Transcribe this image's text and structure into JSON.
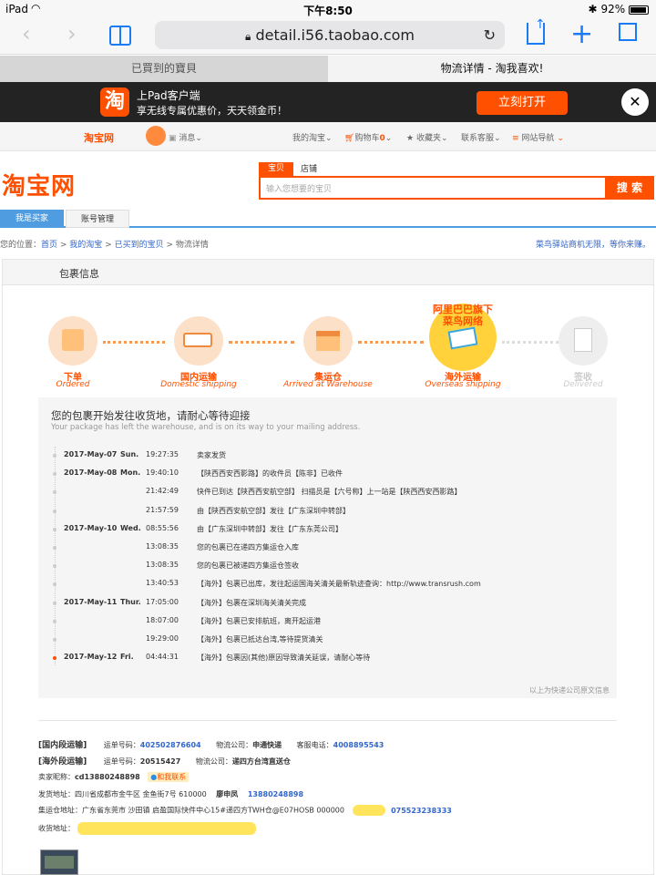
{
  "status": {
    "device": "iPad",
    "time": "下午8:50",
    "battery": "92%"
  },
  "browser": {
    "url": "detail.i56.taobao.com"
  },
  "tabs": [
    {
      "label": "已買到的寶貝"
    },
    {
      "label": "物流详情 - 淘我喜欢!"
    }
  ],
  "banner": {
    "logo": "淘",
    "line1": "上Pad客户端",
    "line2": "享无线专属优惠价，天天领金币！",
    "open": "立刻打开",
    "close": "✕"
  },
  "sitenav": {
    "brand": "淘宝网",
    "messages": "消息",
    "my_taobao": "我的淘宝",
    "cart": "购物车",
    "cart_count": "0",
    "favorites": "收藏夹",
    "service": "联系客服",
    "sitemap": "网站导航"
  },
  "header": {
    "logo": "淘宝网",
    "tab_baby": "宝贝",
    "tab_shop": "店铺",
    "placeholder": "输入您想要的宝贝",
    "search": "搜 索"
  },
  "account_tabs": [
    "我是买家",
    "账号管理"
  ],
  "breadcrumb": {
    "prefix": "您的位置：",
    "home": "首页",
    "my": "我的淘宝",
    "bought": "已买到的宝贝",
    "current": "物流详情",
    "right": "菜鸟驿站商机无限，等你来赚。"
  },
  "package": {
    "title": "包裹信息",
    "steps": [
      {
        "cn": "下单",
        "en": "Ordered"
      },
      {
        "cn": "国内运输",
        "en": "Domestic shipping"
      },
      {
        "cn": "集运仓",
        "en": "Arrived at Warehouse"
      },
      {
        "cn": "海外运输",
        "en": "Overseas shipping"
      },
      {
        "cn": "签收",
        "en": "Delivered"
      }
    ],
    "cainiao": "阿里巴巴旗下\n菜鸟网络",
    "status_cn": "您的包裹开始发往收货地，请耐心等待迎接",
    "status_en": "Your package has left the warehouse, and is on its way to your mailing address.",
    "events": [
      {
        "date": "2017-May-07",
        "wd": "Sun.",
        "time": "19:27:35",
        "desc": "卖家发货"
      },
      {
        "date": "2017-May-08",
        "wd": "Mon.",
        "time": "19:40:10",
        "desc": "【陕西西安西影路】的收件员【陈非】已收件"
      },
      {
        "date": "",
        "wd": "",
        "time": "21:42:49",
        "desc": "快件已到达【陕西西安航空部】 扫描员是【六号称】上一站是【陕西西安西影路】"
      },
      {
        "date": "",
        "wd": "",
        "time": "21:57:59",
        "desc": "由【陕西西安航空部】发往【广东深圳中转部】"
      },
      {
        "date": "2017-May-10",
        "wd": "Wed.",
        "time": "08:55:56",
        "desc": "由【广东深圳中转部】发往【广东东莞公司】"
      },
      {
        "date": "",
        "wd": "",
        "time": "13:08:35",
        "desc": "您的包裹已在递四方集运仓入库"
      },
      {
        "date": "",
        "wd": "",
        "time": "13:08:35",
        "desc": "您的包裹已被递四方集运仓签收"
      },
      {
        "date": "",
        "wd": "",
        "time": "13:40:53",
        "desc": "【海外】包裹已出库，发往起运国海关清关最新轨迹查询：http://www.transrush.com"
      },
      {
        "date": "2017-May-11",
        "wd": "Thur.",
        "time": "17:05:00",
        "desc": "【海外】包裹在深圳海关清关完成"
      },
      {
        "date": "",
        "wd": "",
        "time": "18:07:00",
        "desc": "【海外】包裹已安排航班，离开起运港"
      },
      {
        "date": "",
        "wd": "",
        "time": "19:29:00",
        "desc": "【海外】包裹已抵达台湾,等待提货清关"
      },
      {
        "date": "2017-May-12",
        "wd": "Fri.",
        "time": "04:44:31",
        "desc": "【海外】包裹因(其他)原因导致清关延误，请耐心等待"
      }
    ],
    "footer": "以上为快递公司原文信息"
  },
  "shipping": {
    "domestic_label": "[国内段运输]",
    "waybill_label": "运单号码：",
    "domestic_waybill": "402502876604",
    "company_label": "物流公司：",
    "domestic_company": "申通快递",
    "phone_label": "客服电话：",
    "domestic_phone": "4008895543",
    "overseas_label": "[海外段运输]",
    "overseas_waybill": "20515427",
    "overseas_company": "递四方台湾直送仓",
    "seller_label": "卖家昵称：",
    "seller": "cd13880248898",
    "contact": "和我联系",
    "from_label": "发货地址：",
    "from": "四川省成都市金牛区 金鱼街7号 610000",
    "from_name": "廖申凤",
    "from_phone": "13880248898",
    "wh_label": "集运仓地址：",
    "wh": "广东省东莞市 沙田镇 启盈国际快件中心15#递四方TWH仓@E07HOSB 000000",
    "wh_phone": "075523238333",
    "to_label": "收货地址："
  }
}
